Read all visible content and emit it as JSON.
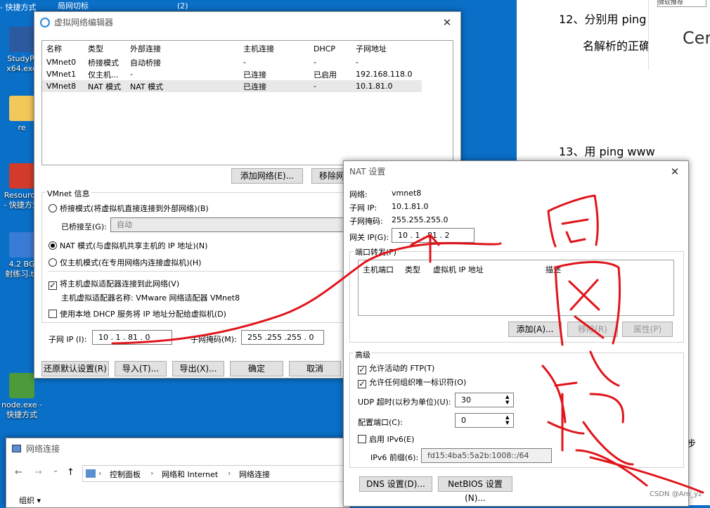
{
  "desktop": {
    "top_labels": [
      "- 快捷方式",
      "局网切标",
      "(2)"
    ],
    "icons": [
      {
        "label": "StudyPl\nx64.exe",
        "color": "#2c5aa0"
      },
      {
        "label": "re",
        "color": "#f2c85b"
      },
      {
        "label": "Resource\n- 快捷方式",
        "color": "#d23a2a"
      },
      {
        "label": "4.2 BG\n射练习.to",
        "color": "#3a7bd5"
      },
      {
        "label": "node.exe -\n快捷方式",
        "color": "#4c9a3a"
      }
    ]
  },
  "doc": {
    "line12a": "12、分别用 ping",
    "line12b": "名解析的正确",
    "cer": "Cer",
    "tooltip": "微软推荐",
    "line13": "13、用 ping www",
    "bu": "步",
    "watermark": "CSDN @Am_yz"
  },
  "vne": {
    "title": "虚拟网络编辑器",
    "columns": [
      "名称",
      "类型",
      "外部连接",
      "主机连接",
      "DHCP",
      "子网地址"
    ],
    "rows": [
      [
        "VMnet0",
        "桥接模式",
        "自动桥接",
        "-",
        "-",
        "-"
      ],
      [
        "VMnet1",
        "仅主机...",
        "-",
        "已连接",
        "已启用",
        "192.168.118.0"
      ],
      [
        "VMnet8",
        "NAT 模式",
        "NAT 模式",
        "已连接",
        "-",
        "10.1.81.0"
      ]
    ],
    "add_network": "添加网络(E)...",
    "remove_network": "移除网",
    "vmnet_info": "VMnet 信息",
    "bridge_mode": "桥接模式(将虚拟机直接连接到外部网络)(B)",
    "bridged_to": "已桥接至(G):",
    "bridged_value": "自动",
    "nat_mode": "NAT 模式(与虚拟机共享主机的 IP 地址)(N)",
    "host_only": "仅主机模式(在专用网络内连接虚拟机)(H)",
    "connect_adapter": "将主机虚拟适配器连接到此网络(V)",
    "adapter_name": "主机虚拟适配器名称: VMware 网络适配器 VMnet8",
    "use_dhcp": "使用本地 DHCP 服务将 IP 地址分配给虚拟机(D)",
    "subnet_ip_label": "子网 IP (I):",
    "subnet_ip": "10  .  1  . 81  .  0",
    "mask_label": "子网掩码(M):",
    "mask": "255 .255 .255 .  0",
    "restore": "还原默认设置(R)",
    "import": "导入(T)...",
    "export": "导出(X)...",
    "ok": "确定",
    "cancel": "取消"
  },
  "nat": {
    "title": "NAT 设置",
    "network_label": "网络:",
    "network": "vmnet8",
    "subnet_ip_label": "子网 IP:",
    "subnet_ip": "10.1.81.0",
    "mask_label": "子网掩码:",
    "mask": "255.255.255.0",
    "gateway_label": "网关 IP(G):",
    "gateway": "10  .  1  . 81  .  2",
    "port_forward": "端口转发(F)",
    "pf_columns": [
      "主机端口",
      "类型",
      "虚拟机 IP 地址",
      "描述"
    ],
    "add": "添加(A)...",
    "remove": "移除(R)",
    "properties": "属性(P)",
    "advanced": "高级",
    "allow_ftp": "允许活动的 FTP(T)",
    "allow_any_oui": "允许任何组织唯一标识符(O)",
    "udp_label": "UDP 超时(以秒为单位)(U):",
    "udp_value": "30",
    "config_port_label": "配置端口(C):",
    "config_port_value": "0",
    "ipv6": "启用 IPv6(E)",
    "ipv6_prefix_label": "IPv6 前缀(6):",
    "ipv6_prefix": "fd15:4ba5:5a2b:1008::/64",
    "dns": "DNS 设置(D)...",
    "netbios": "NetBIOS 设置(N)..."
  },
  "explorer": {
    "title": "网络连接",
    "breadcrumb": [
      "控制面板",
      "网络和 Internet",
      "网络连接"
    ],
    "organize": "组织 ▾"
  },
  "annotation": {
    "handwriting": "同网段",
    "color": "#e0151c"
  }
}
